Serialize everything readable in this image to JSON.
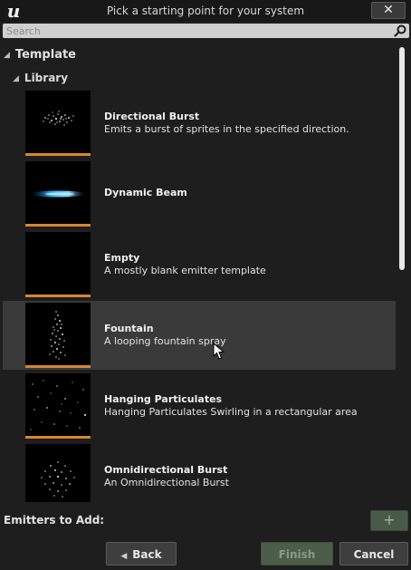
{
  "window": {
    "title": "Pick a starting point for your system",
    "close_label": "✕"
  },
  "search": {
    "placeholder": "Search",
    "value": ""
  },
  "tree": {
    "root_label": "Template",
    "group_label": "Library"
  },
  "items": [
    {
      "name": "Directional Burst",
      "description": "Emits a burst of sprites in the specified direction.",
      "thumbnail": "burst-particles"
    },
    {
      "name": "Dynamic Beam",
      "description": "",
      "thumbnail": "blue-beam"
    },
    {
      "name": "Empty",
      "description": "A mostly blank emitter template",
      "thumbnail": "blank"
    },
    {
      "name": "Fountain",
      "description": "A looping fountain spray",
      "thumbnail": "fountain-particles",
      "selected": true
    },
    {
      "name": "Hanging Particulates",
      "description": "Hanging Particulates Swirling in a rectangular area",
      "thumbnail": "sparse-particles"
    },
    {
      "name": "Omnidirectional Burst",
      "description": "An Omnidirectional Burst",
      "thumbnail": "omni-particles"
    }
  ],
  "bottom": {
    "emitters_label": "Emitters to Add:",
    "add_icon": "+",
    "back_label": "Back",
    "back_icon": "◀",
    "finish_label": "Finish",
    "cancel_label": "Cancel"
  },
  "colors": {
    "accent_bar": "#d98531",
    "background": "#1e1e1e",
    "selected_row": "#3a3a3a",
    "finish_disabled": "#4b5e4a"
  }
}
